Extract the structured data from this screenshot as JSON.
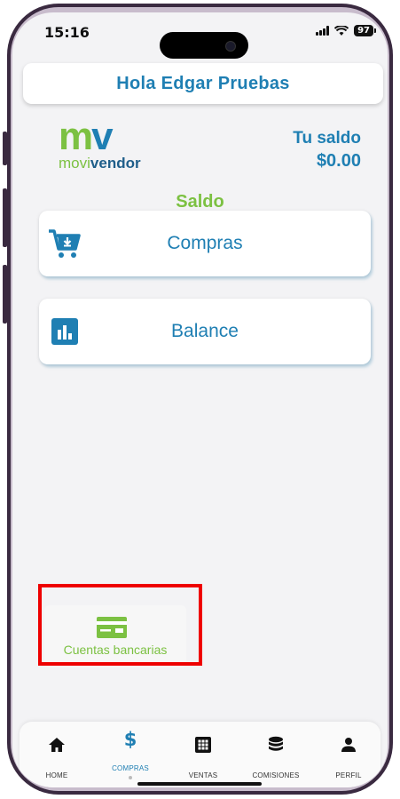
{
  "status_bar": {
    "time": "15:16",
    "battery": "97"
  },
  "header": {
    "greeting": "Hola Edgar Pruebas"
  },
  "brand": {
    "mark_m": "m",
    "mark_v": "v",
    "word_movi": "movi",
    "word_vendor": "vendor"
  },
  "balance": {
    "label": "Tu saldo",
    "amount": "$0.00"
  },
  "section": {
    "title": "Saldo"
  },
  "menu": [
    {
      "label": "Compras",
      "icon": "cart-download-icon"
    },
    {
      "label": "Balance",
      "icon": "bar-chart-icon"
    }
  ],
  "shortcut": {
    "label": "Cuentas bancarias",
    "icon": "bank-card-icon"
  },
  "tabbar": [
    {
      "label": "HOME",
      "icon": "home-icon"
    },
    {
      "label": "COMPRAS",
      "icon": "dollar-icon",
      "active": true
    },
    {
      "label": "VENTAS",
      "icon": "calculator-icon"
    },
    {
      "label": "COMISIONES",
      "icon": "coins-icon"
    },
    {
      "label": "PERFIL",
      "icon": "user-icon"
    }
  ],
  "colors": {
    "brand_blue": "#1f7fb3",
    "brand_green": "#7cc142",
    "highlight": "#ee0000"
  }
}
